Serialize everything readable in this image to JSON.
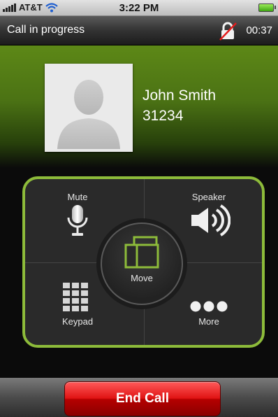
{
  "status_bar": {
    "carrier": "AT&T",
    "time": "3:22 PM",
    "icons": [
      "signal-icon",
      "wifi-icon",
      "battery-icon"
    ]
  },
  "call": {
    "title": "Call in progress",
    "duration": "00:37",
    "lock_icon": "lock-crossed-icon"
  },
  "contact": {
    "name": "John Smith",
    "number": "31234",
    "photo_icon": "contact-silhouette-icon"
  },
  "controls": {
    "mute_label": "Mute",
    "speaker_label": "Speaker",
    "move_label": "Move",
    "keypad_label": "Keypad",
    "more_label": "More",
    "accent_color": "#8dbb3a"
  },
  "end_call": {
    "label": "End Call",
    "color": "#e01414"
  }
}
